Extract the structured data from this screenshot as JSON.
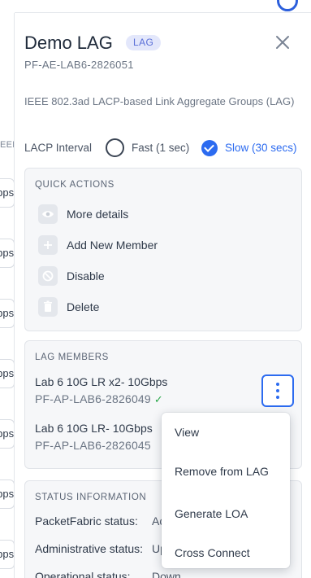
{
  "background": {
    "column_label": "EED",
    "rows": [
      "Gbps",
      "Gbps",
      "Gbps",
      "Gbps",
      "Gbps",
      "Gbps",
      "Gbps"
    ]
  },
  "drawer": {
    "title": "Demo LAG",
    "badge": "LAG",
    "sub_id": "PF-AE-LAB6-2826051",
    "description": "IEEE 802.3ad LACP-based Link Aggregate Groups (LAG)",
    "close_icon": "close-icon"
  },
  "lacp": {
    "label": "LACP Interval",
    "options": [
      {
        "label": "Fast (1 sec)",
        "selected": false
      },
      {
        "label": "Slow (30 secs)",
        "selected": true
      }
    ]
  },
  "quick_actions": {
    "heading": "QUICK ACTIONS",
    "items": [
      {
        "label": "More details",
        "icon": "eye-icon"
      },
      {
        "label": "Add New Member",
        "icon": "plus-icon"
      },
      {
        "label": "Disable",
        "icon": "ban-icon"
      },
      {
        "label": "Delete",
        "icon": "trash-icon"
      }
    ]
  },
  "lag_members": {
    "heading": "LAG MEMBERS",
    "members": [
      {
        "name": "Lab 6 10G LR x2- 10Gbps",
        "id": "PF-AP-LAB6-2826049",
        "status_icon": "check-icon"
      },
      {
        "name": "Lab 6 10G LR- 10Gbps",
        "id": "PF-AP-LAB6-2826045"
      }
    ]
  },
  "status_info": {
    "heading": "STATUS INFORMATION",
    "rows": [
      {
        "label": "PacketFabric status:",
        "value": "Ac"
      },
      {
        "label": "Administrative status:",
        "value": "Up"
      },
      {
        "label": "Operational status:",
        "value": "Down"
      }
    ]
  },
  "context_menu": {
    "items": [
      "View",
      "Remove from LAG",
      "Generate LOA",
      "Cross Connect"
    ]
  },
  "colors": {
    "accent": "#2c6bf0",
    "badge_bg": "#e3e7fb",
    "badge_text": "#5a6fd8",
    "success": "#2aa84a"
  }
}
